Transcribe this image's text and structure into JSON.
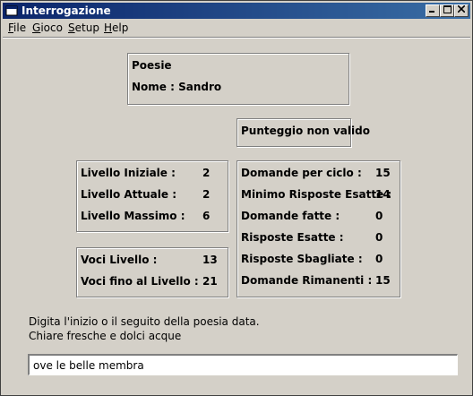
{
  "window": {
    "title": "Interrogazione"
  },
  "menu": [
    "File",
    "Gioco",
    "Setup",
    "Help"
  ],
  "poem": {
    "title": "Poesie",
    "name_label": "Nome : Sandro"
  },
  "score_status": "Punteggio non valido",
  "levels": [
    {
      "label": "Livello Iniziale :",
      "value": "2"
    },
    {
      "label": "Livello Attuale  :",
      "value": "2"
    },
    {
      "label": "Livello Massimo  :",
      "value": "6"
    }
  ],
  "voices": [
    {
      "label": "Voci Livello     :",
      "value": "13"
    },
    {
      "label": "Voci fino al Livello :",
      "value": "21"
    }
  ],
  "stats": [
    {
      "label": "Domande per ciclo :",
      "value": "15"
    },
    {
      "label": "Minimo Risposte Esatte :",
      "value": "14"
    },
    {
      "label": "Domande fatte :",
      "value": "0"
    },
    {
      "label": "Risposte Esatte :",
      "value": "0"
    },
    {
      "label": "Risposte Sbagliate :",
      "value": "0"
    },
    {
      "label": "Domande Rimanenti :",
      "value": "15"
    }
  ],
  "instruction": "Digita l'inizio o il seguito della poesia data.",
  "verse": "Chiare fresche e dolci acque",
  "answer_input": {
    "value": "ove le belle membra"
  }
}
